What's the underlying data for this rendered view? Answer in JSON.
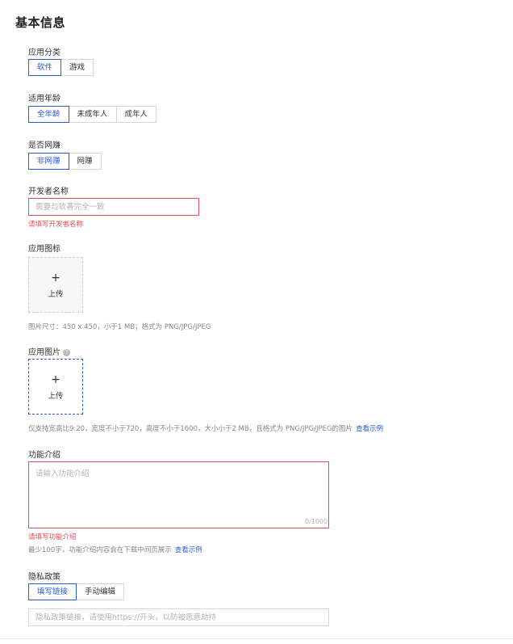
{
  "section_title": "基本信息",
  "category": {
    "label": "应用分类",
    "options": [
      "软件",
      "游戏"
    ],
    "selected": 0
  },
  "age": {
    "label": "适用年龄",
    "options": [
      "全年龄",
      "未成年人",
      "成年人"
    ],
    "selected": 0
  },
  "online_game": {
    "label": "是否网赚",
    "options": [
      "非网赚",
      "网赚"
    ],
    "selected": 0
  },
  "developer": {
    "label": "开发者名称",
    "placeholder": "需要与软著完全一致",
    "value": "",
    "error": "请填写开发者名称"
  },
  "app_icon": {
    "label": "应用图标",
    "upload_plus": "+",
    "upload_text": "上传",
    "hint": "图片尺寸：450 x 450，小于1 MB；格式为 PNG/JPG/JPEG"
  },
  "app_images": {
    "label": "应用图片",
    "help_icon": "?",
    "upload_plus": "+",
    "upload_text": "上传",
    "hint": "仅支持宽高比9:20，宽度不小于720，高度不小于1600，大小小于2 MB，且格式为 PNG/JPG/JPEG的图片",
    "example_link": "查看示例"
  },
  "description": {
    "label": "功能介绍",
    "placeholder": "请输入功能介绍",
    "value": "",
    "counter": "0/1000",
    "error": "请填写功能介绍",
    "hint": "最少100字，功能介绍内容会在下载中间页展示",
    "example_link": "查看示例"
  },
  "privacy": {
    "label": "隐私政策",
    "options": [
      "填写链接",
      "手动编辑"
    ],
    "selected": 0,
    "placeholder": "隐私政策链接，请使用https://开头，以防被恶意劫持",
    "value": ""
  },
  "colors": {
    "accent": "#2a5bd7",
    "error": "#e34d59",
    "border": "#d9d9d9"
  }
}
